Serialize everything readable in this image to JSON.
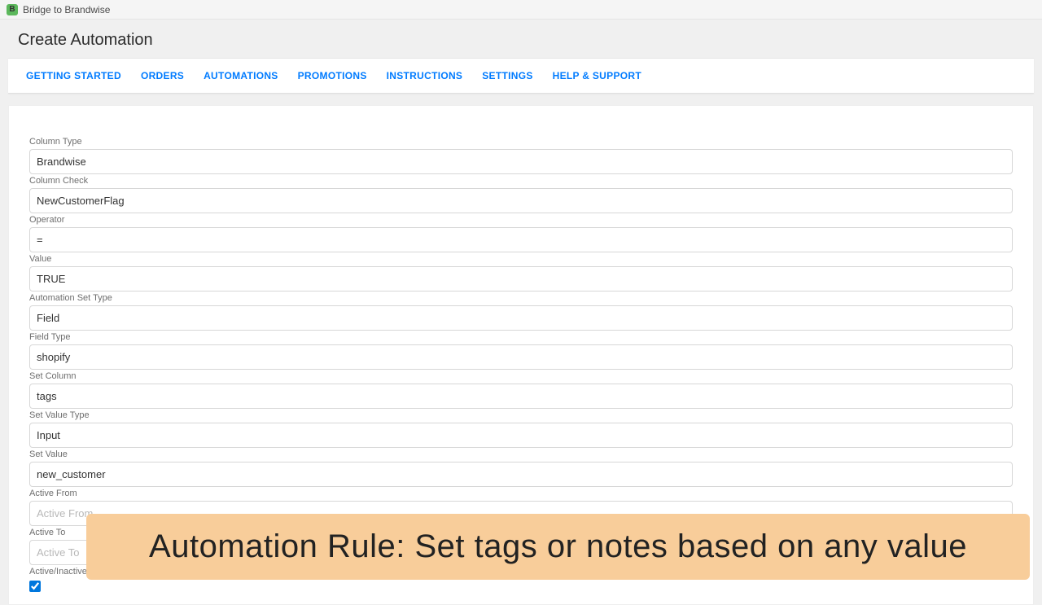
{
  "app": {
    "title": "Bridge to Brandwise"
  },
  "page": {
    "title": "Create Automation"
  },
  "tabs": {
    "getting_started": "GETTING STARTED",
    "orders": "ORDERS",
    "automations": "AUTOMATIONS",
    "promotions": "PROMOTIONS",
    "instructions": "INSTRUCTIONS",
    "settings": "SETTINGS",
    "help": "HELP & SUPPORT"
  },
  "form": {
    "column_type": {
      "label": "Column Type",
      "value": "Brandwise"
    },
    "column_check": {
      "label": "Column Check",
      "value": "NewCustomerFlag"
    },
    "operator": {
      "label": "Operator",
      "value": "="
    },
    "value": {
      "label": "Value",
      "value": "TRUE"
    },
    "automation_set_type": {
      "label": "Automation Set Type",
      "value": "Field"
    },
    "field_type": {
      "label": "Field Type",
      "value": "shopify"
    },
    "set_column": {
      "label": "Set Column",
      "value": "tags"
    },
    "set_value_type": {
      "label": "Set Value Type",
      "value": "Input"
    },
    "set_value": {
      "label": "Set Value",
      "value": "new_customer"
    },
    "active_from": {
      "label": "Active From",
      "value": "",
      "placeholder": "Active From"
    },
    "active_to": {
      "label": "Active To",
      "value": "",
      "placeholder": "Active To"
    },
    "active_inactive": {
      "label": "Active/Inactive",
      "checked": true
    }
  },
  "banner": {
    "text": "Automation Rule: Set tags or notes based on any value"
  }
}
